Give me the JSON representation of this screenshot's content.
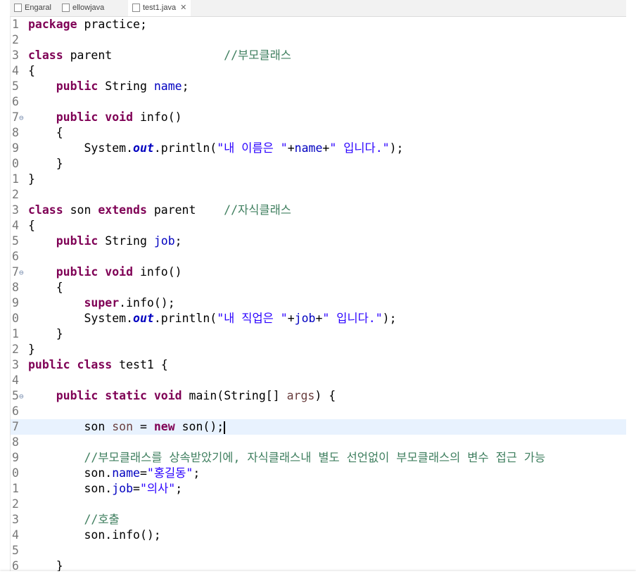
{
  "tabs": [
    {
      "label": "Engaral",
      "active": false
    },
    {
      "label": "ellowjava",
      "active": false
    },
    {
      "label": "test1.java",
      "active": true,
      "close": "✕"
    }
  ],
  "lines": [
    {
      "n": "1",
      "fold": false,
      "current": false,
      "tokens": [
        {
          "t": "package",
          "c": "kw"
        },
        {
          "t": " practice;"
        }
      ]
    },
    {
      "n": "2",
      "fold": false,
      "current": false,
      "tokens": []
    },
    {
      "n": "3",
      "fold": false,
      "current": false,
      "tokens": [
        {
          "t": "class",
          "c": "kw"
        },
        {
          "t": " parent                "
        },
        {
          "t": "//부모클래스",
          "c": "cmt"
        }
      ]
    },
    {
      "n": "4",
      "fold": false,
      "current": false,
      "tokens": [
        {
          "t": "{"
        }
      ]
    },
    {
      "n": "5",
      "fold": false,
      "current": false,
      "tokens": [
        {
          "t": "    "
        },
        {
          "t": "public",
          "c": "kw"
        },
        {
          "t": " String "
        },
        {
          "t": "name",
          "c": "fld"
        },
        {
          "t": ";"
        }
      ]
    },
    {
      "n": "6",
      "fold": false,
      "current": false,
      "tokens": []
    },
    {
      "n": "7",
      "fold": true,
      "current": false,
      "tokens": [
        {
          "t": "    "
        },
        {
          "t": "public",
          "c": "kw"
        },
        {
          "t": " "
        },
        {
          "t": "void",
          "c": "kw"
        },
        {
          "t": " info()"
        }
      ]
    },
    {
      "n": "8",
      "fold": false,
      "current": false,
      "tokens": [
        {
          "t": "    {"
        }
      ]
    },
    {
      "n": "9",
      "fold": false,
      "current": false,
      "tokens": [
        {
          "t": "        System."
        },
        {
          "t": "out",
          "c": "sfld"
        },
        {
          "t": ".println("
        },
        {
          "t": "\"내 이름은 \"",
          "c": "str"
        },
        {
          "t": "+"
        },
        {
          "t": "name",
          "c": "fld"
        },
        {
          "t": "+"
        },
        {
          "t": "\" 입니다.\"",
          "c": "str"
        },
        {
          "t": ");"
        }
      ]
    },
    {
      "n": "0",
      "fold": false,
      "current": false,
      "tokens": [
        {
          "t": "    }"
        }
      ]
    },
    {
      "n": "1",
      "fold": false,
      "current": false,
      "tokens": [
        {
          "t": "}"
        }
      ]
    },
    {
      "n": "2",
      "fold": false,
      "current": false,
      "tokens": []
    },
    {
      "n": "3",
      "fold": false,
      "current": false,
      "tokens": [
        {
          "t": "class",
          "c": "kw"
        },
        {
          "t": " son "
        },
        {
          "t": "extends",
          "c": "kw"
        },
        {
          "t": " parent    "
        },
        {
          "t": "//자식클래스",
          "c": "cmt"
        }
      ]
    },
    {
      "n": "4",
      "fold": false,
      "current": false,
      "tokens": [
        {
          "t": "{"
        }
      ]
    },
    {
      "n": "5",
      "fold": false,
      "current": false,
      "tokens": [
        {
          "t": "    "
        },
        {
          "t": "public",
          "c": "kw"
        },
        {
          "t": " String "
        },
        {
          "t": "job",
          "c": "fld"
        },
        {
          "t": ";"
        }
      ]
    },
    {
      "n": "6",
      "fold": false,
      "current": false,
      "tokens": []
    },
    {
      "n": "7",
      "fold": true,
      "current": false,
      "tokens": [
        {
          "t": "    "
        },
        {
          "t": "public",
          "c": "kw"
        },
        {
          "t": " "
        },
        {
          "t": "void",
          "c": "kw"
        },
        {
          "t": " info()"
        }
      ]
    },
    {
      "n": "8",
      "fold": false,
      "current": false,
      "tokens": [
        {
          "t": "    {"
        }
      ]
    },
    {
      "n": "9",
      "fold": false,
      "current": false,
      "tokens": [
        {
          "t": "        "
        },
        {
          "t": "super",
          "c": "kw"
        },
        {
          "t": ".info();"
        }
      ]
    },
    {
      "n": "0",
      "fold": false,
      "current": false,
      "tokens": [
        {
          "t": "        System."
        },
        {
          "t": "out",
          "c": "sfld"
        },
        {
          "t": ".println("
        },
        {
          "t": "\"내 직업은 \"",
          "c": "str"
        },
        {
          "t": "+"
        },
        {
          "t": "job",
          "c": "fld"
        },
        {
          "t": "+"
        },
        {
          "t": "\" 입니다.\"",
          "c": "str"
        },
        {
          "t": ");"
        }
      ]
    },
    {
      "n": "1",
      "fold": false,
      "current": false,
      "tokens": [
        {
          "t": "    }"
        }
      ]
    },
    {
      "n": "2",
      "fold": false,
      "current": false,
      "tokens": [
        {
          "t": "}"
        }
      ]
    },
    {
      "n": "3",
      "fold": false,
      "current": false,
      "tokens": [
        {
          "t": "public",
          "c": "kw"
        },
        {
          "t": " "
        },
        {
          "t": "class",
          "c": "kw"
        },
        {
          "t": " test1 {"
        }
      ]
    },
    {
      "n": "4",
      "fold": false,
      "current": false,
      "tokens": []
    },
    {
      "n": "5",
      "fold": true,
      "current": false,
      "tokens": [
        {
          "t": "    "
        },
        {
          "t": "public",
          "c": "kw"
        },
        {
          "t": " "
        },
        {
          "t": "static",
          "c": "kw"
        },
        {
          "t": " "
        },
        {
          "t": "void",
          "c": "kw"
        },
        {
          "t": " main(String[] "
        },
        {
          "t": "args",
          "c": "var"
        },
        {
          "t": ") {"
        }
      ]
    },
    {
      "n": "6",
      "fold": false,
      "current": false,
      "tokens": []
    },
    {
      "n": "7",
      "fold": false,
      "current": true,
      "tokens": [
        {
          "t": "        son "
        },
        {
          "t": "son",
          "c": "var"
        },
        {
          "t": " = "
        },
        {
          "t": "new",
          "c": "kw"
        },
        {
          "t": " son();"
        },
        {
          "t": "",
          "c": "caret"
        }
      ]
    },
    {
      "n": "8",
      "fold": false,
      "current": false,
      "tokens": []
    },
    {
      "n": "9",
      "fold": false,
      "current": false,
      "tokens": [
        {
          "t": "        "
        },
        {
          "t": "//부모클래스를 상속받았기에, 자식클래스내 별도 선언없이 부모클래스의 변수 접근 가능",
          "c": "cmt"
        }
      ]
    },
    {
      "n": "0",
      "fold": false,
      "current": false,
      "tokens": [
        {
          "t": "        son."
        },
        {
          "t": "name",
          "c": "fld"
        },
        {
          "t": "="
        },
        {
          "t": "\"홍길동\"",
          "c": "str"
        },
        {
          "t": ";"
        }
      ]
    },
    {
      "n": "1",
      "fold": false,
      "current": false,
      "tokens": [
        {
          "t": "        son."
        },
        {
          "t": "job",
          "c": "fld"
        },
        {
          "t": "="
        },
        {
          "t": "\"의사\"",
          "c": "str"
        },
        {
          "t": ";"
        }
      ]
    },
    {
      "n": "2",
      "fold": false,
      "current": false,
      "tokens": []
    },
    {
      "n": "3",
      "fold": false,
      "current": false,
      "tokens": [
        {
          "t": "        "
        },
        {
          "t": "//호출",
          "c": "cmt"
        }
      ]
    },
    {
      "n": "4",
      "fold": false,
      "current": false,
      "tokens": [
        {
          "t": "        son.info();"
        }
      ]
    },
    {
      "n": "5",
      "fold": false,
      "current": false,
      "tokens": []
    },
    {
      "n": "6",
      "fold": false,
      "current": false,
      "tokens": [
        {
          "t": "    }"
        }
      ]
    }
  ]
}
